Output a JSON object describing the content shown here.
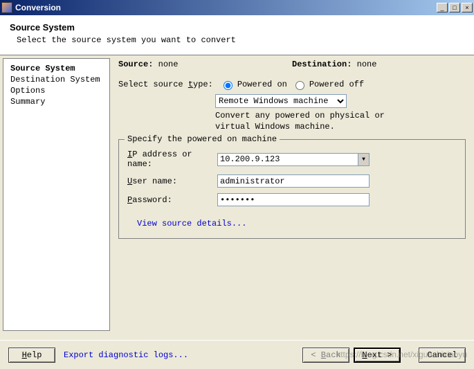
{
  "window": {
    "title": "Conversion"
  },
  "header": {
    "title": "Source System",
    "subtitle": "Select the source system you want to convert"
  },
  "sidebar": {
    "items": [
      {
        "label": "Source System",
        "active": true
      },
      {
        "label": "Destination System",
        "active": false
      },
      {
        "label": "Options",
        "active": false
      },
      {
        "label": "Summary",
        "active": false
      }
    ]
  },
  "main": {
    "source_label": "Source:",
    "source_value": "none",
    "destination_label": "Destination:",
    "destination_value": "none",
    "select_type_label": "Select source type:",
    "radio_powered_on": "Powered on",
    "radio_powered_off": "Powered off",
    "radio_selected": "on",
    "dropdown_value": "Remote Windows machine",
    "hint": "Convert any powered on physical or virtual Windows machine.",
    "fieldset_legend": "Specify the powered on machine",
    "fields": {
      "ip_label": "IP address or name:",
      "ip_value": "10.200.9.123",
      "user_label": "User name:",
      "user_value": "administrator",
      "password_label": "Password:",
      "password_value": "•••••••"
    },
    "details_link": "View source details..."
  },
  "footer": {
    "help": "Help",
    "export_link": "Export diagnostic logs...",
    "back": "< Back",
    "next": "Next >",
    "cancel": "Cancel"
  },
  "watermark": "https://blog.csdn.net/xiguashixiaoyu"
}
